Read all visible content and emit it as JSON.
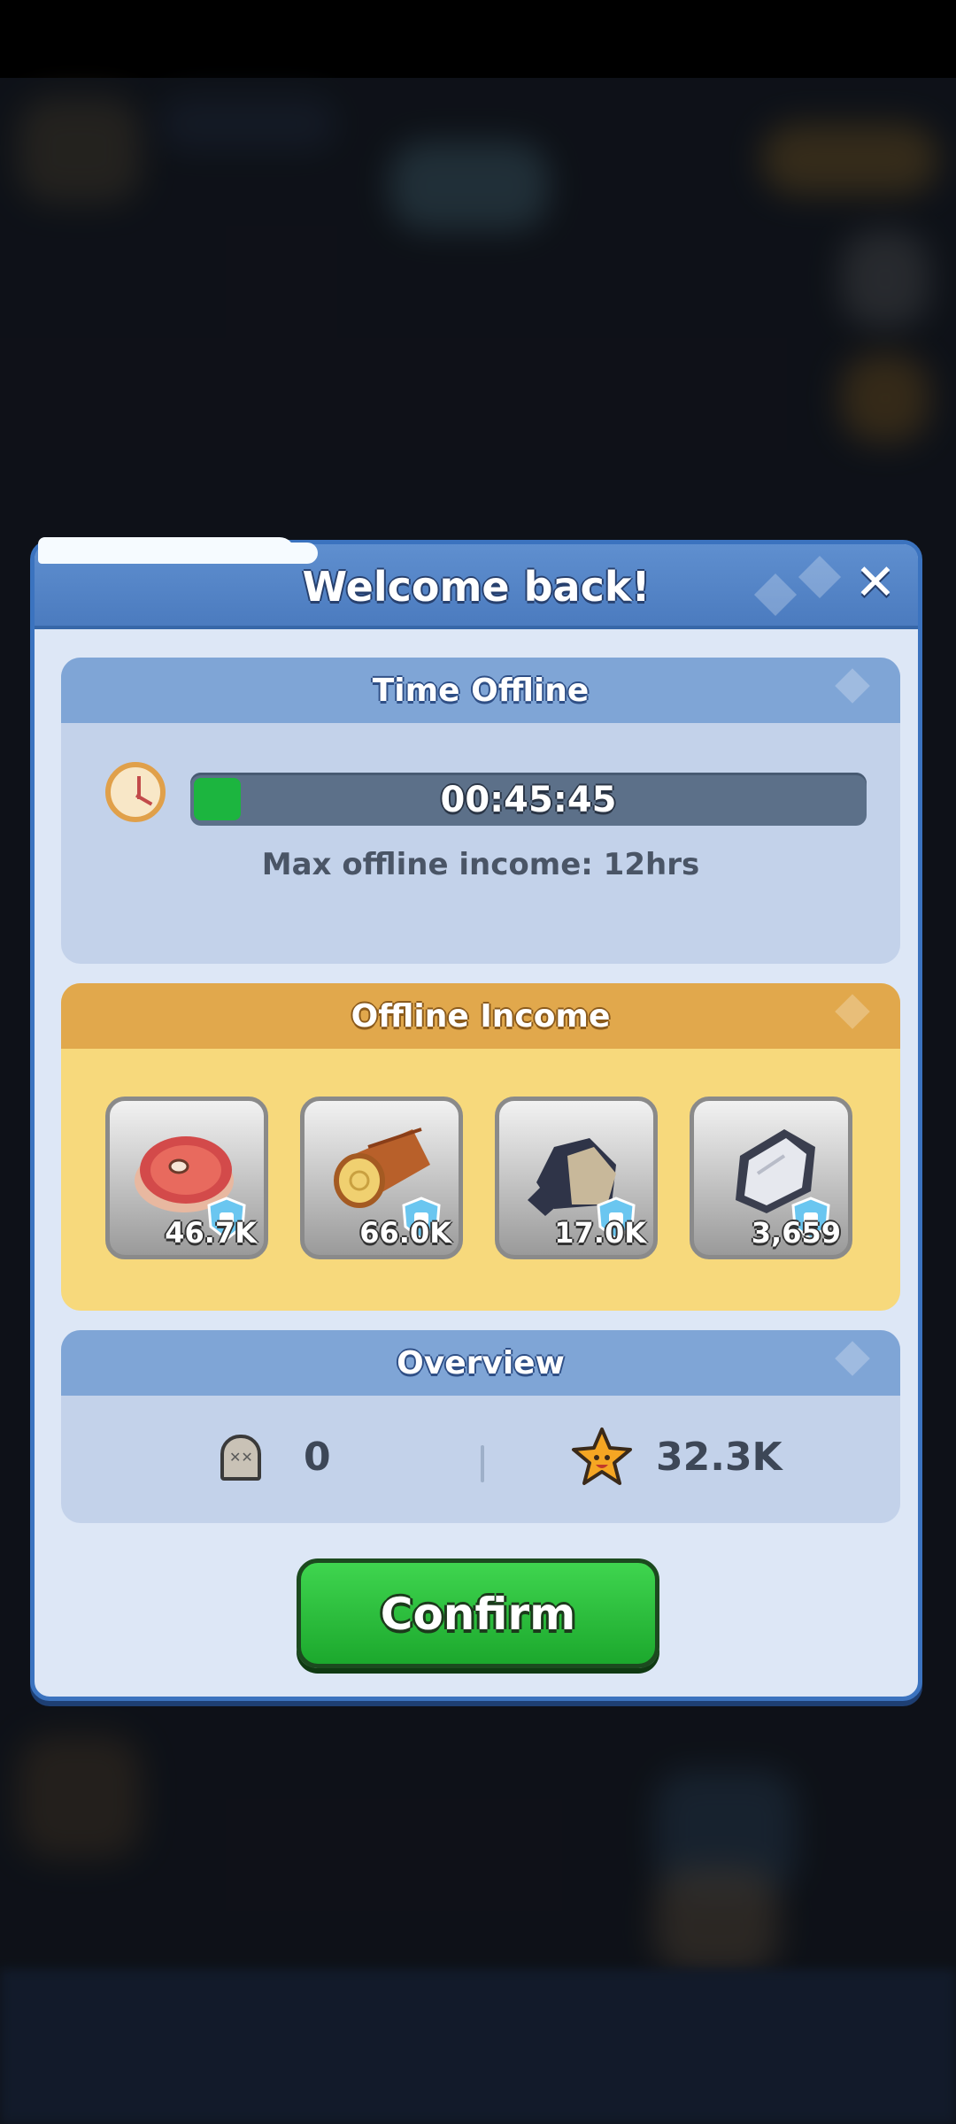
{
  "dialog": {
    "title": "Welcome back!",
    "close_icon": "close-icon"
  },
  "time_offline": {
    "header": "Time Offline",
    "timer": "00:45:45",
    "progress": 0.07,
    "max_income_text": "Max offline income: 12hrs",
    "fill_color": "#1cb53f"
  },
  "offline_income": {
    "header": "Offline Income",
    "resources": [
      {
        "icon": "meat-icon",
        "amount": "46.7K"
      },
      {
        "icon": "wood-log-icon",
        "amount": "66.0K"
      },
      {
        "icon": "stone-icon",
        "amount": "17.0K"
      },
      {
        "icon": "iron-ore-icon",
        "amount": "3,659"
      }
    ]
  },
  "overview": {
    "header": "Overview",
    "kills": "0",
    "stars": "32.3K"
  },
  "confirm_label": "Confirm",
  "colors": {
    "dialog_border": "#3b73bf",
    "header_blue": "#7fa5d6",
    "income_gold": "#e1a84c",
    "confirm_green": "#1ca82d"
  }
}
